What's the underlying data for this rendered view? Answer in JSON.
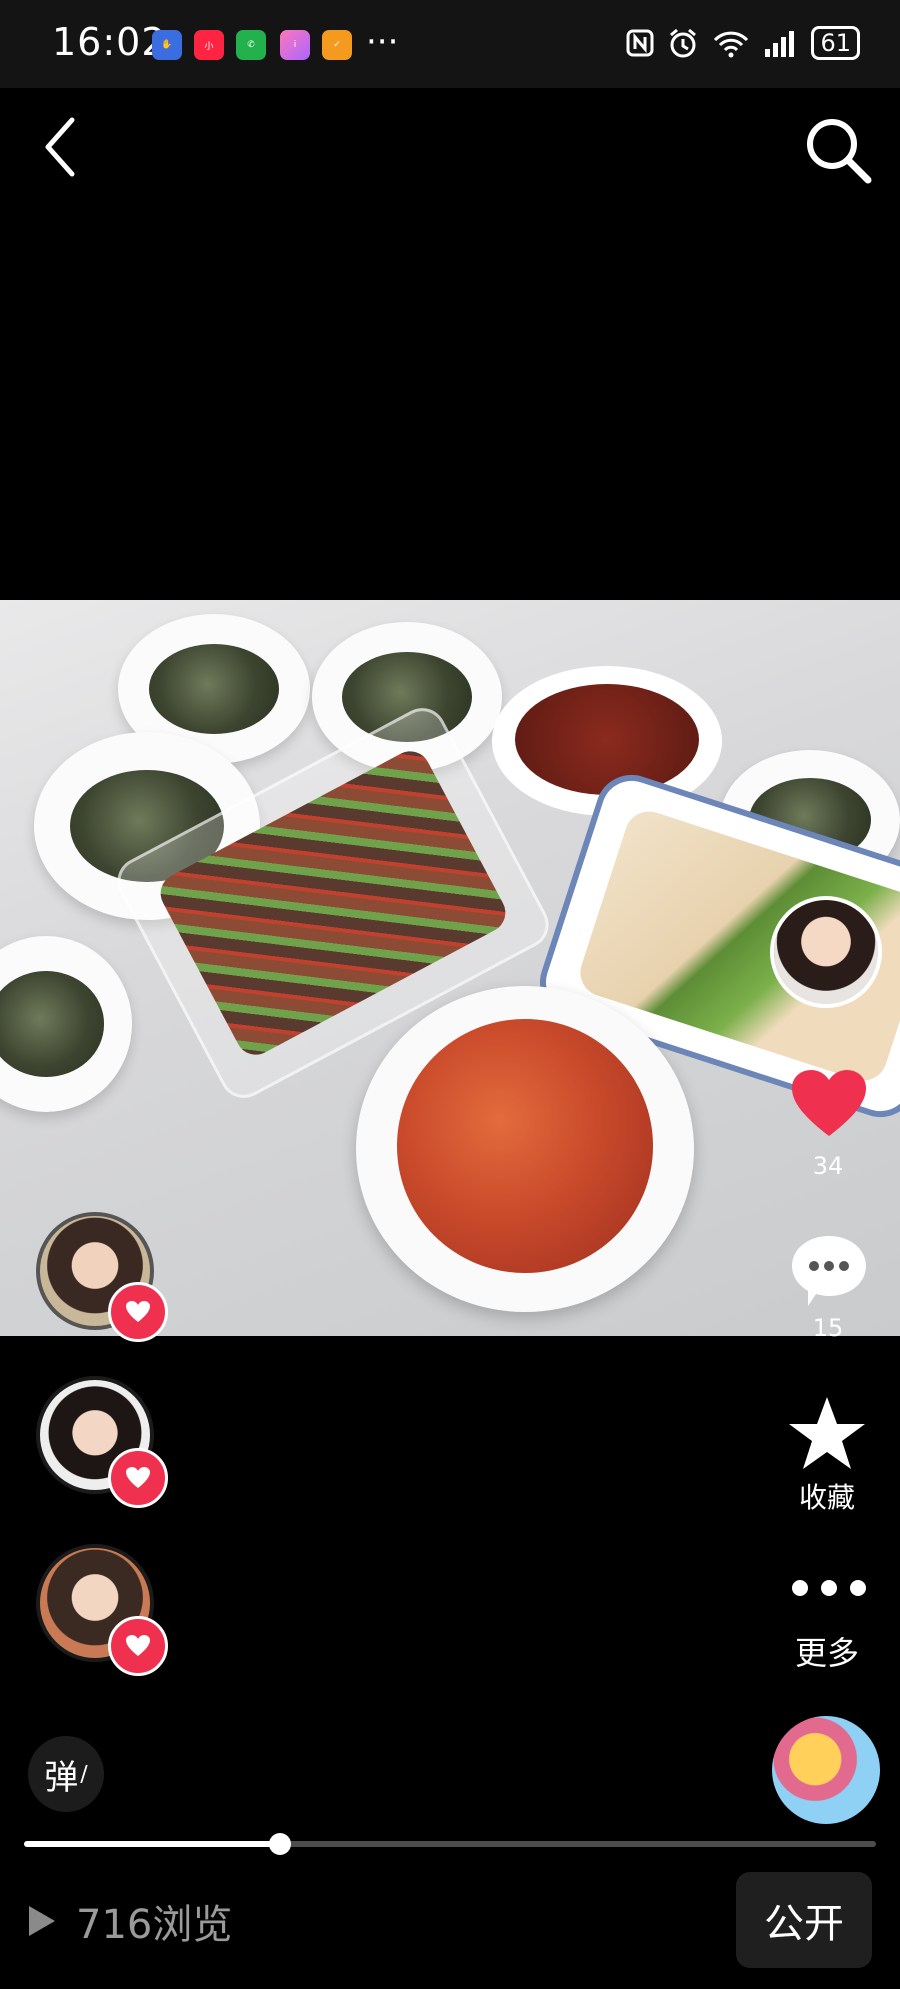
{
  "status_bar": {
    "time": "16:02",
    "battery": "61",
    "more_indicator": "···",
    "app_icons": [
      {
        "name": "touch-assist-icon",
        "color": "#3a6ee0"
      },
      {
        "name": "xiaohongshu-icon",
        "color": "#ff2442"
      },
      {
        "name": "phone-icon",
        "color": "#22b14c"
      },
      {
        "name": "app-icon-gradient",
        "color": "#e85aa6"
      },
      {
        "name": "app-icon-orange",
        "color": "#f39a1f"
      }
    ],
    "system_icons": [
      "nfc-icon",
      "alarm-icon",
      "wifi-6-icon",
      "signal-icon"
    ]
  },
  "header": {
    "back_icon": "chevron-left-icon",
    "search_icon": "search-icon"
  },
  "rail": {
    "likes_count": "34",
    "comments_count": "15",
    "favorite_label": "收藏",
    "more_label": "更多"
  },
  "likers": [
    {
      "name": "liker-avatar-1"
    },
    {
      "name": "liker-avatar-2"
    },
    {
      "name": "liker-avatar-3"
    }
  ],
  "bottom": {
    "danmu_label": "弹",
    "progress": 0.3,
    "views_text": "716浏览",
    "public_label": "公开"
  },
  "colors": {
    "accent": "#f0304f",
    "background": "#000000",
    "muted_text": "#9a9a9a"
  }
}
